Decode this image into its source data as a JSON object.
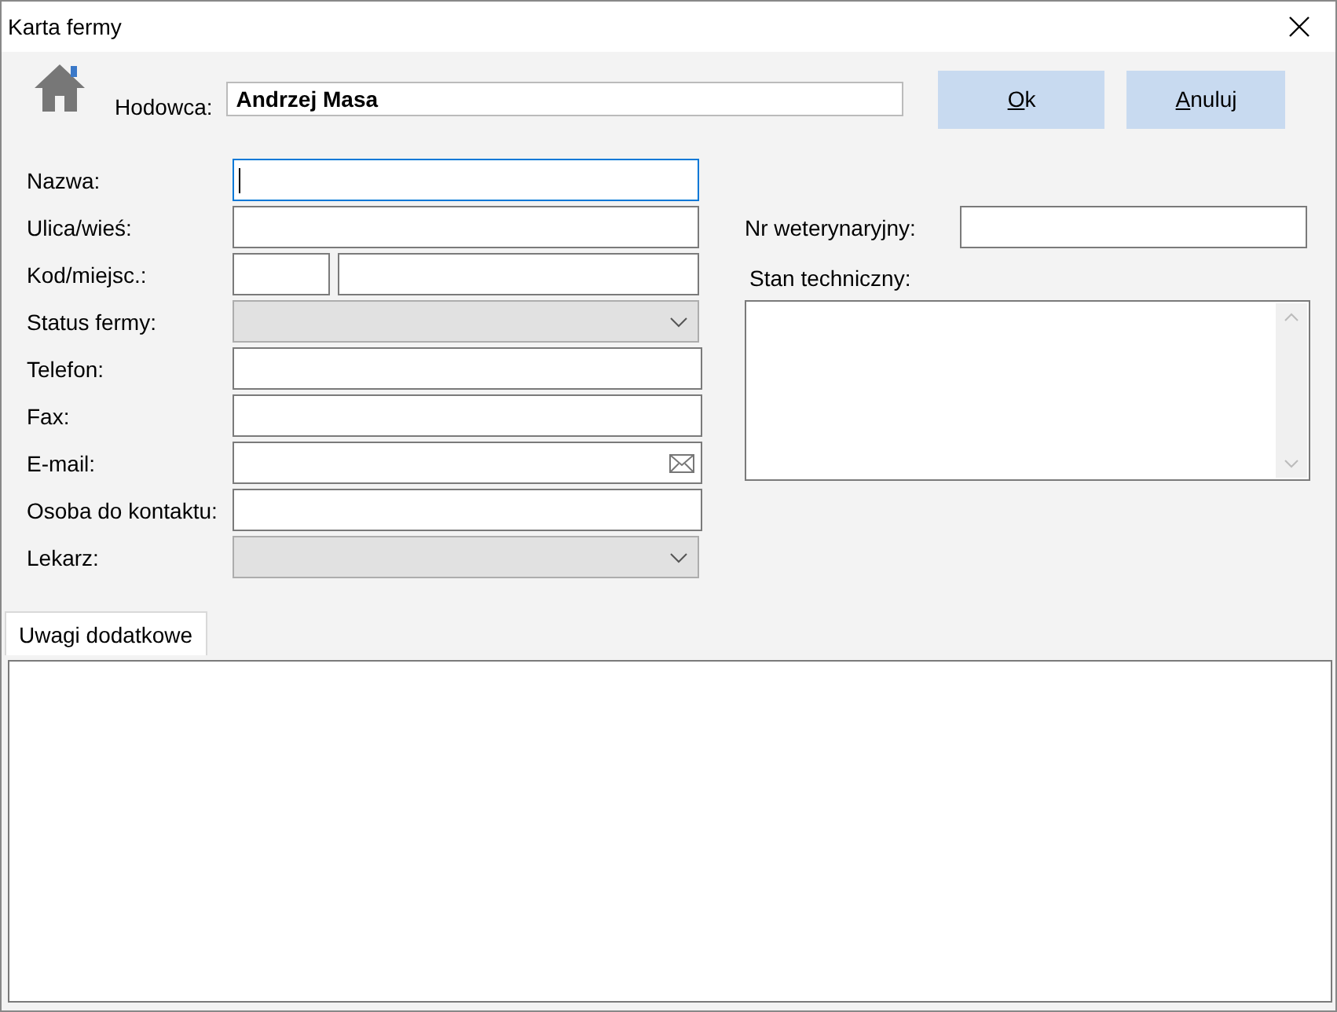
{
  "window": {
    "title": "Karta fermy"
  },
  "header": {
    "label": "Hodowca:",
    "value": "Andrzej Masa"
  },
  "buttons": [
    "Ok",
    "Anuluj"
  ],
  "fields": [
    {
      "label": "Nazwa:",
      "kind": "text",
      "focused": true
    },
    {
      "label": "Ulica/wieś:",
      "kind": "text",
      "focused": false
    },
    {
      "label": "Kod/miejsc.:",
      "kind": "split",
      "focused": false
    },
    {
      "label": "Status fermy:",
      "kind": "combo",
      "disabled": true,
      "focused": false
    },
    {
      "label": "Telefon:",
      "kind": "text",
      "focused": false
    },
    {
      "label": "Fax:",
      "kind": "text",
      "focused": false
    },
    {
      "label": "E-mail:",
      "kind": "email",
      "focused": false
    },
    {
      "label": "Osoba do kontaktu:",
      "kind": "text",
      "focused": false
    },
    {
      "label": "Lekarz:",
      "kind": "combo",
      "disabled": true,
      "focused": false
    }
  ],
  "vet_number": {
    "label": "Nr weterynaryjny:"
  },
  "technical_state": {
    "label": "Stan techniczny:"
  },
  "tabs": [
    {
      "label": "Uwagi dodatkowe",
      "selected": true
    }
  ]
}
